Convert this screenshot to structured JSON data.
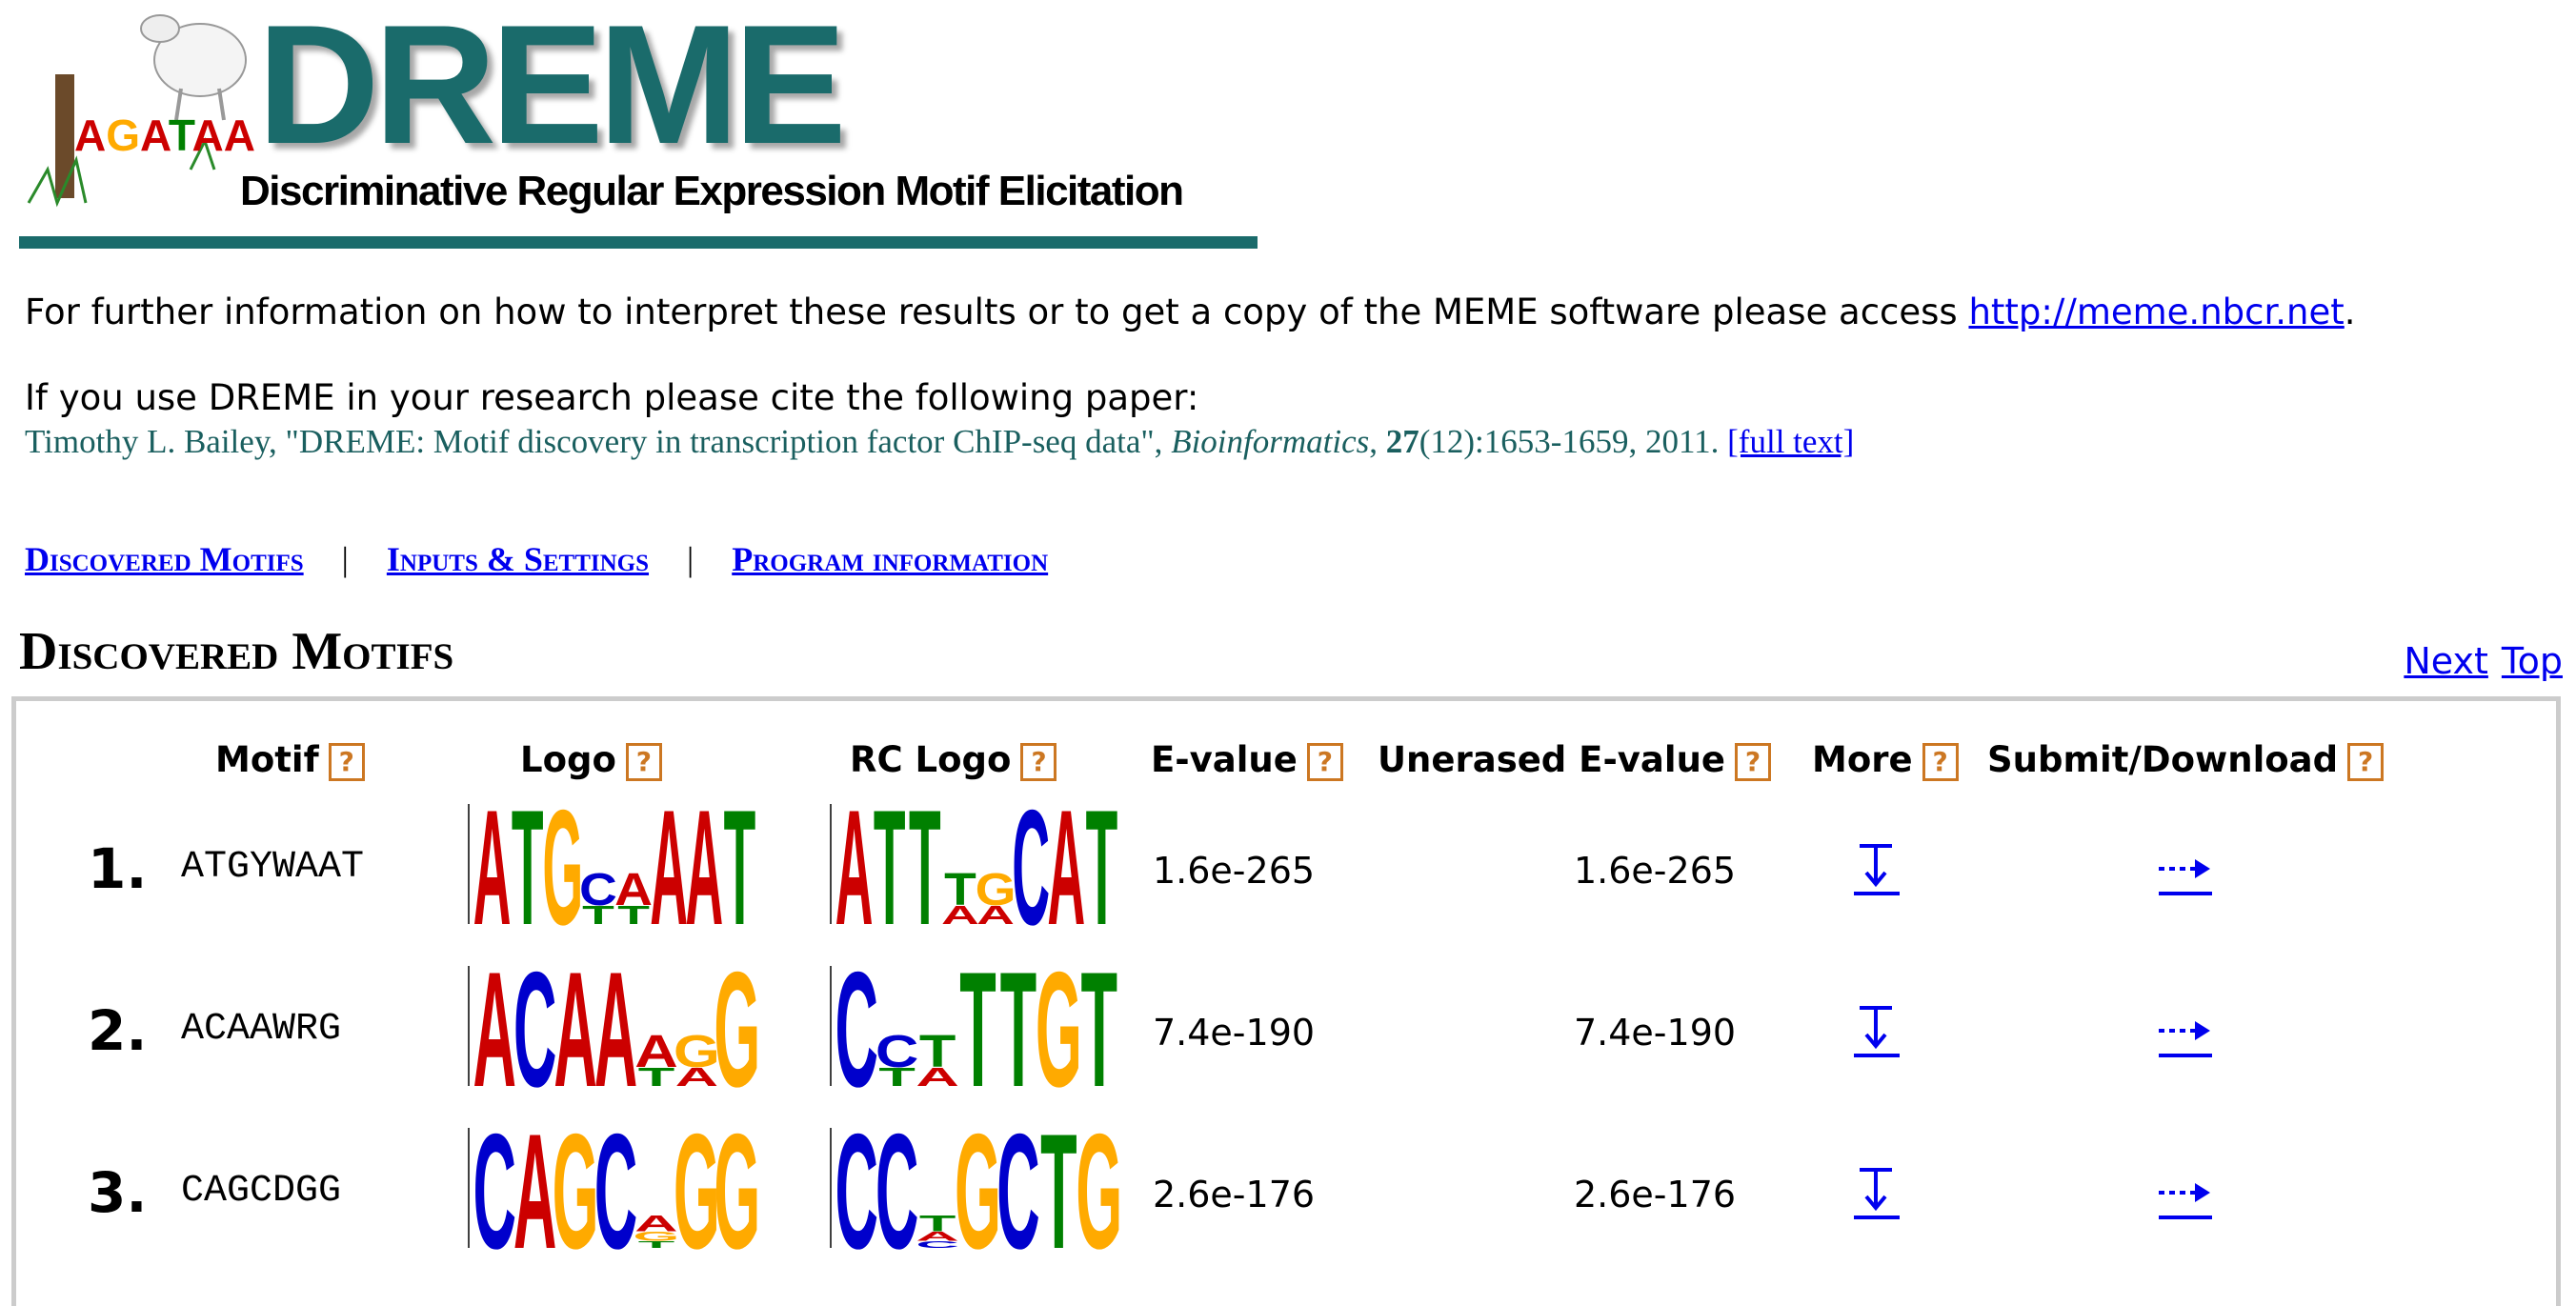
{
  "header": {
    "title": "DREME",
    "subtitle": "Discriminative Regular Expression Motif Elicitation",
    "brand_color": "#1a6b6b",
    "logo_letters": "AGATAA"
  },
  "info": {
    "text_before": "For further information on how to interpret these results or to get a copy of the MEME software please access ",
    "link": "http://meme.nbcr.net",
    "text_after": "."
  },
  "citation": {
    "intro": "If you use DREME in your research please cite the following paper:",
    "authors_title": "Timothy L. Bailey, \"DREME: Motif discovery in transcription factor ChIP-seq data\", ",
    "journal": "Bioinformatics",
    "volume": "27",
    "pages": "(12):1653-1659, 2011. ",
    "fulltext": "[full text]"
  },
  "nav": {
    "items": [
      "Discovered Motifs",
      "Inputs & Settings",
      "Program information"
    ],
    "separator": "|"
  },
  "section": {
    "title": "Discovered Motifs",
    "next": "Next",
    "top": "Top"
  },
  "table": {
    "headers": [
      "Motif",
      "Logo",
      "RC Logo",
      "E-value",
      "Unerased E-value",
      "More",
      "Submit/Download"
    ],
    "help_glyph": "?",
    "rows": [
      {
        "num": "1.",
        "motif": "ATGYWAAT",
        "evalue": "1.6e-265",
        "unerased": "1.6e-265",
        "logo": [
          [
            "A"
          ],
          [
            "T"
          ],
          [
            "G"
          ],
          [
            "C",
            "T"
          ],
          [
            "A",
            "T"
          ],
          [
            "A"
          ],
          [
            "A"
          ],
          [
            "T"
          ]
        ],
        "rc_logo": [
          [
            "A"
          ],
          [
            "T"
          ],
          [
            "T"
          ],
          [
            "T",
            "A"
          ],
          [
            "G",
            "A"
          ],
          [
            "C"
          ],
          [
            "A"
          ],
          [
            "T"
          ]
        ]
      },
      {
        "num": "2.",
        "motif": "ACAAWRG",
        "evalue": "7.4e-190",
        "unerased": "7.4e-190",
        "logo": [
          [
            "A"
          ],
          [
            "C"
          ],
          [
            "A"
          ],
          [
            "A"
          ],
          [
            "A",
            "T"
          ],
          [
            "G",
            "A"
          ],
          [
            "G"
          ]
        ],
        "rc_logo": [
          [
            "C"
          ],
          [
            "C",
            "T"
          ],
          [
            "T",
            "A"
          ],
          [
            "T"
          ],
          [
            "T"
          ],
          [
            "G"
          ],
          [
            "T"
          ]
        ]
      },
      {
        "num": "3.",
        "motif": "CAGCDGG",
        "evalue": "2.6e-176",
        "unerased": "2.6e-176",
        "logo": [
          [
            "C"
          ],
          [
            "A"
          ],
          [
            "G"
          ],
          [
            "C"
          ],
          [
            "A",
            "G",
            "T"
          ],
          [
            "G"
          ],
          [
            "G"
          ]
        ],
        "rc_logo": [
          [
            "C"
          ],
          [
            "C"
          ],
          [
            "T",
            "A",
            "C"
          ],
          [
            "G"
          ],
          [
            "C"
          ],
          [
            "T"
          ],
          [
            "G"
          ]
        ]
      }
    ]
  },
  "colors": {
    "A": "#cc0000",
    "C": "#0000cc",
    "G": "#ffaa00",
    "T": "#008000",
    "link": "#0000ee",
    "help": "#cc7722"
  }
}
